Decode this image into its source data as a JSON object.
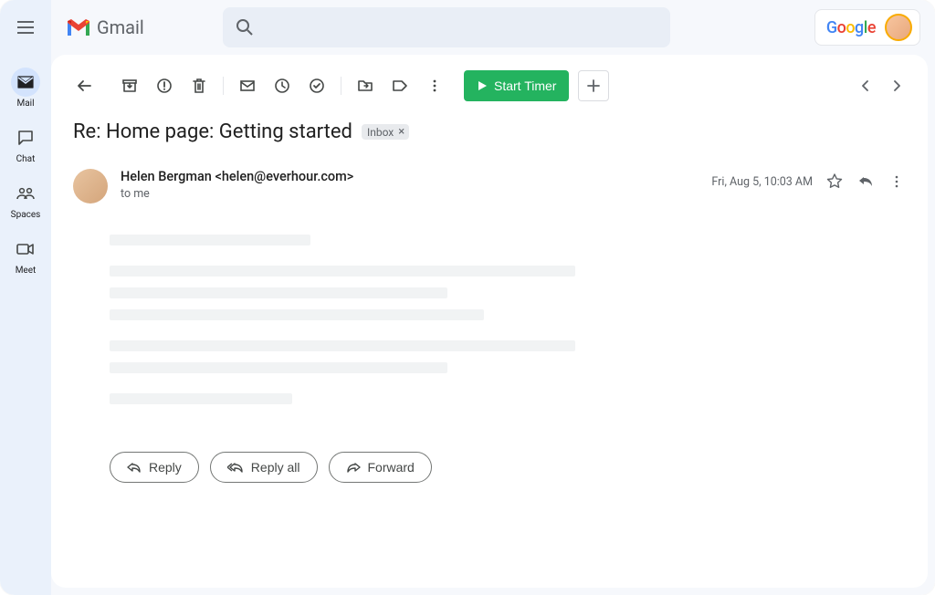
{
  "app": {
    "name": "Gmail"
  },
  "leftrail": {
    "items": [
      {
        "id": "mail",
        "label": "Mail",
        "active": true
      },
      {
        "id": "chat",
        "label": "Chat",
        "active": false
      },
      {
        "id": "spaces",
        "label": "Spaces",
        "active": false
      },
      {
        "id": "meet",
        "label": "Meet",
        "active": false
      }
    ]
  },
  "topbar": {
    "google_label": "Google"
  },
  "toolbar": {
    "start_timer_label": "Start Timer"
  },
  "email": {
    "subject": "Re: Home page: Getting started",
    "label_chip": "Inbox",
    "sender": "Helen Bergman <helen@everhour.com>",
    "recipient": "to me",
    "timestamp": "Fri, Aug 5, 10:03 AM"
  },
  "actions": {
    "reply": "Reply",
    "reply_all": "Reply all",
    "forward": "Forward"
  }
}
